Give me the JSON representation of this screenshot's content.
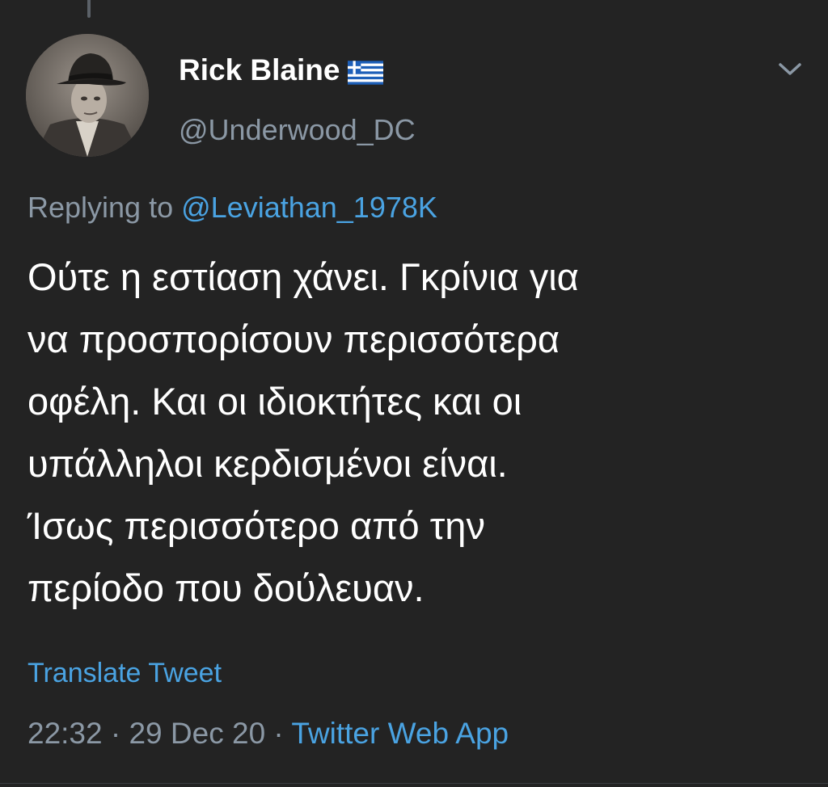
{
  "tweet": {
    "display_name": "Rick Blaine",
    "name_flag_icon": "greek-flag-icon",
    "handle": "@Underwood_DC",
    "replying_prefix": "Replying to",
    "replying_to": "@Leviathan_1978K",
    "text_lines": [
      "Ούτε η εστίαση χάνει. Γκρίνια για",
      "να προσπορίσουν περισσότερα",
      "οφέλη. Και οι ιδιοκτήτες και οι",
      "υπάλληλοι κερδισμένοι είναι.",
      "Ίσως περισσότερο από την",
      "περίοδο που δούλευαν."
    ],
    "translate_label": "Translate Tweet",
    "time": "22:32",
    "date": "29 Dec 20",
    "separator": " · ",
    "source": "Twitter Web App"
  },
  "colors": {
    "background": "#232323",
    "primary_text": "#ffffff",
    "secondary_text": "#8b98a5",
    "link": "#4aa3e2"
  }
}
